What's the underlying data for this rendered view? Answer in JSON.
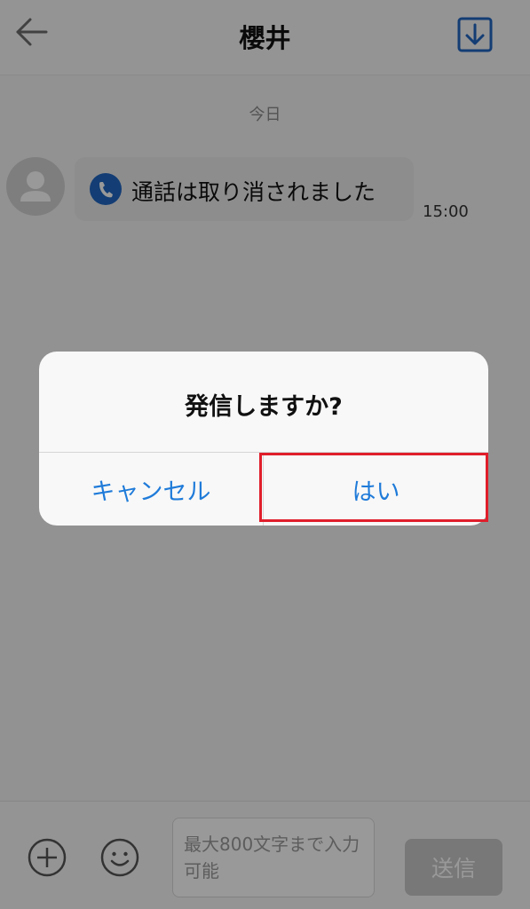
{
  "header": {
    "title": "櫻井",
    "back_icon": "arrow-left-icon",
    "download_icon": "download-icon",
    "accent_color": "#2166c2"
  },
  "chat": {
    "date_label": "今日",
    "messages": [
      {
        "text": "通話は取り消されました",
        "time": "15:00",
        "icon": "phone-icon"
      }
    ]
  },
  "input_bar": {
    "placeholder": "最大800文字まで入力可能",
    "send_label": "送信",
    "plus_icon": "plus-circle-icon",
    "emoji_icon": "smiley-icon"
  },
  "dialog": {
    "title": "発信しますか?",
    "cancel_label": "キャンセル",
    "confirm_label": "はい",
    "button_color": "#1f7bd9",
    "highlight_color": "#e01e2b"
  }
}
